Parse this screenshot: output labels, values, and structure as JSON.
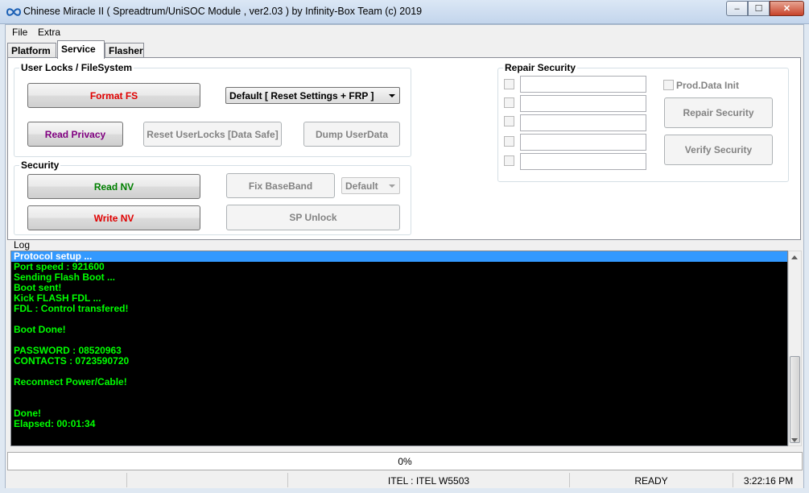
{
  "window": {
    "title": "Chinese Miracle II ( Spreadtrum/UniSOC Module , ver2.03  ) by Infinity-Box Team (c) 2019",
    "min_glyph": "–",
    "max_glyph": "☐",
    "close_glyph": "✕"
  },
  "menu": {
    "items": [
      "File",
      "Extra"
    ]
  },
  "tabs": {
    "items": [
      "Platform",
      "Service",
      "Flasher"
    ],
    "active": "Service"
  },
  "user_locks": {
    "title": "User Locks  / FileSystem",
    "format_fs": "Format FS",
    "format_mode": "Default [ Reset Settings + FRP ]",
    "read_privacy": "Read Privacy",
    "reset_userlocks": "Reset UserLocks [Data Safe]",
    "dump_userdata": "Dump UserData"
  },
  "security": {
    "title": "Security",
    "read_nv": "Read NV",
    "write_nv": "Write NV",
    "fix_baseband": "Fix BaseBand",
    "baseband_mode": "Default",
    "sp_unlock": "SP Unlock"
  },
  "repair_security": {
    "title": "Repair Security",
    "fields": [
      "",
      "",
      "",
      "",
      ""
    ],
    "prod_data_init": "Prod.Data Init",
    "repair_button": "Repair Security",
    "verify_button": "Verify Security"
  },
  "log": {
    "label": "Log",
    "lines": [
      "Protocol setup ...",
      "Port speed : 921600",
      "Sending Flash Boot ...",
      "Boot sent!",
      "Kick FLASH FDL ...",
      "FDL : Control transfered!",
      "",
      "Boot Done!",
      "",
      "PASSWORD : 08520963",
      "CONTACTS : 0723590720",
      "",
      "Reconnect Power/Cable!",
      "",
      "",
      "Done!",
      "Elapsed: 00:01:34"
    ],
    "selected_index": 0
  },
  "progress": {
    "text": "0%",
    "value": 0
  },
  "status": {
    "cells": [
      "",
      "",
      "ITEL : ITEL W5503",
      "READY",
      "3:22:16 PM"
    ]
  },
  "colors": {
    "log_bg": "#000000",
    "log_text": "#00ff00",
    "selection": "#3399ff"
  }
}
